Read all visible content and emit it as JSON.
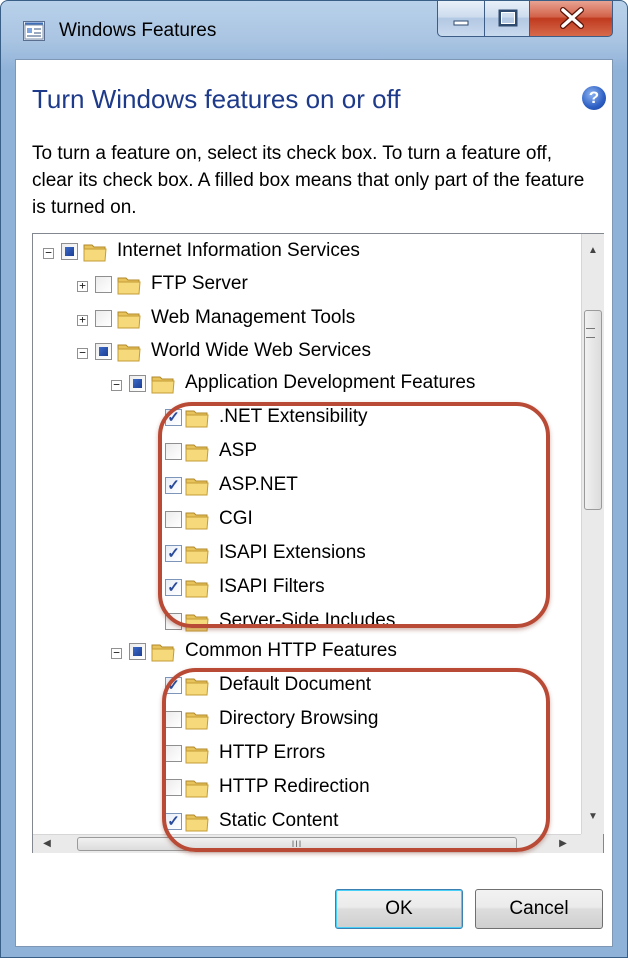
{
  "window": {
    "title": "Windows Features",
    "heading": "Turn Windows features on or off",
    "description": "To turn a feature on, select its check box. To turn a feature off, clear its check box. A filled box means that only part of the feature is turned on.",
    "help_glyph": "?",
    "accent_color": "#1e3a8a"
  },
  "tree": {
    "items": [
      {
        "label": "Internet Information Services",
        "state": "partial",
        "expander": "minus"
      },
      {
        "label": "FTP Server",
        "state": "unchecked",
        "expander": "plus"
      },
      {
        "label": "Web Management Tools",
        "state": "unchecked",
        "expander": "plus"
      },
      {
        "label": "World Wide Web Services",
        "state": "partial",
        "expander": "minus"
      },
      {
        "label": "Application Development Features",
        "state": "partial",
        "expander": "minus"
      },
      {
        "label": ".NET Extensibility",
        "state": "checked"
      },
      {
        "label": "ASP",
        "state": "unchecked"
      },
      {
        "label": "ASP.NET",
        "state": "checked"
      },
      {
        "label": "CGI",
        "state": "unchecked"
      },
      {
        "label": "ISAPI Extensions",
        "state": "checked"
      },
      {
        "label": "ISAPI Filters",
        "state": "checked"
      },
      {
        "label": "Server-Side Includes",
        "state": "unchecked"
      },
      {
        "label": "Common HTTP Features",
        "state": "partial",
        "expander": "minus"
      },
      {
        "label": "Default Document",
        "state": "checked"
      },
      {
        "label": "Directory Browsing",
        "state": "unchecked"
      },
      {
        "label": "HTTP Errors",
        "state": "unchecked"
      },
      {
        "label": "HTTP Redirection",
        "state": "unchecked"
      },
      {
        "label": "Static Content",
        "state": "checked"
      }
    ]
  },
  "scrollbar": {
    "h_thumb_grip": "III"
  },
  "buttons": {
    "ok": "OK",
    "cancel": "Cancel"
  },
  "annotation_color": "#b94a35"
}
